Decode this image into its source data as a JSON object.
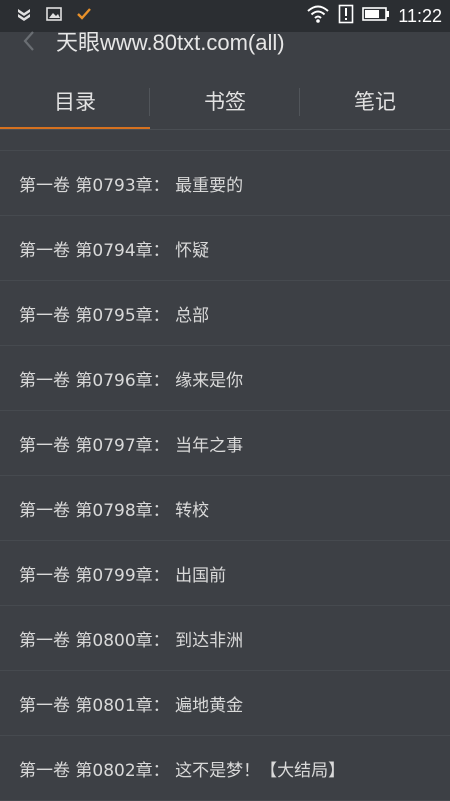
{
  "status_bar": {
    "time": "11:22",
    "icons": [
      "notification-shield-icon",
      "image-icon",
      "check-icon",
      "wifi-icon",
      "alert-icon",
      "battery-icon"
    ]
  },
  "header": {
    "book_title": "天眼www.80txt.com(all)"
  },
  "tabs": [
    {
      "label": "目录",
      "active": true
    },
    {
      "label": "书签",
      "active": false
    },
    {
      "label": "笔记",
      "active": false
    }
  ],
  "chapters": [
    "第一卷 第0793章： 最重要的",
    "第一卷 第0794章： 怀疑",
    "第一卷 第0795章： 总部",
    "第一卷 第0796章： 缘来是你",
    "第一卷 第0797章： 当年之事",
    "第一卷 第0798章： 转校",
    "第一卷 第0799章： 出国前",
    "第一卷 第0800章： 到达非洲",
    "第一卷 第0801章： 遍地黄金",
    "第一卷 第0802章： 这不是梦！【大结局】"
  ],
  "colors": {
    "background": "#3d4045",
    "status_bar": "#2b2e32",
    "accent": "#d6711f",
    "text": "#d9d9d9"
  }
}
